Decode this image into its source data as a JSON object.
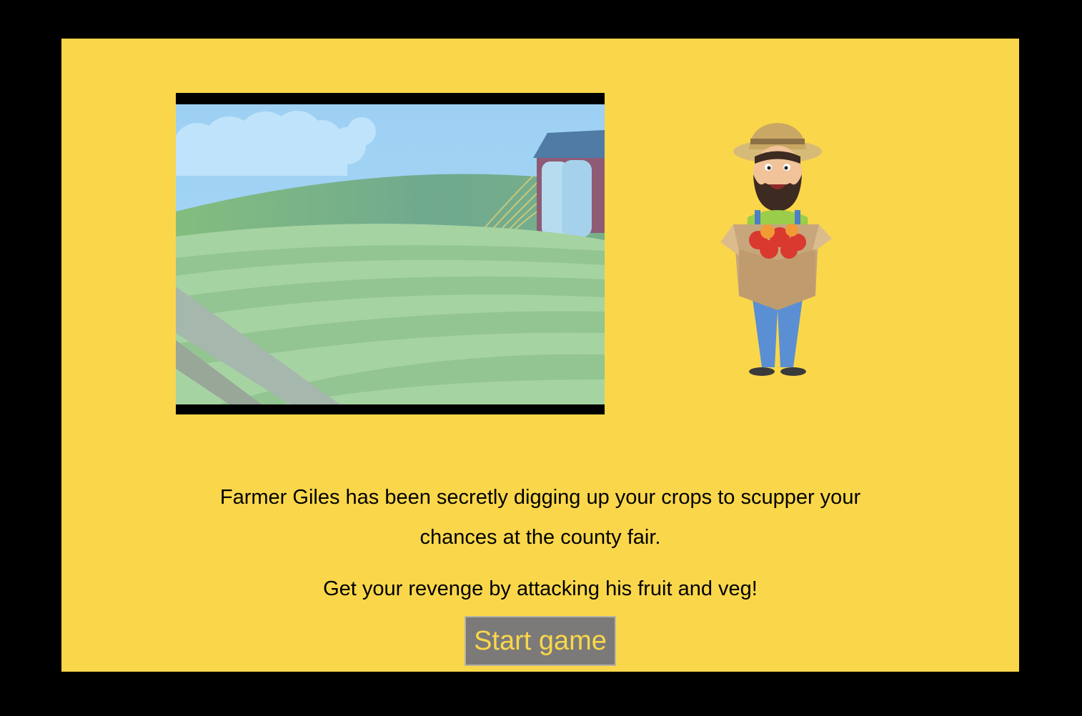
{
  "story": {
    "line_one": "Farmer Giles has been secretly digging up your crops to scupper your chances at the county fair.",
    "line_two": "Get your revenge by attacking his fruit and veg!"
  },
  "start_button": {
    "label": "Start game"
  },
  "colors": {
    "page_background": "#000000",
    "panel_background": "#fad74a",
    "button_background": "#7b7a78",
    "button_text": "#fad74a"
  },
  "icons": {
    "video": "farm-scene-video",
    "character": "farmer-giles-illustration"
  }
}
